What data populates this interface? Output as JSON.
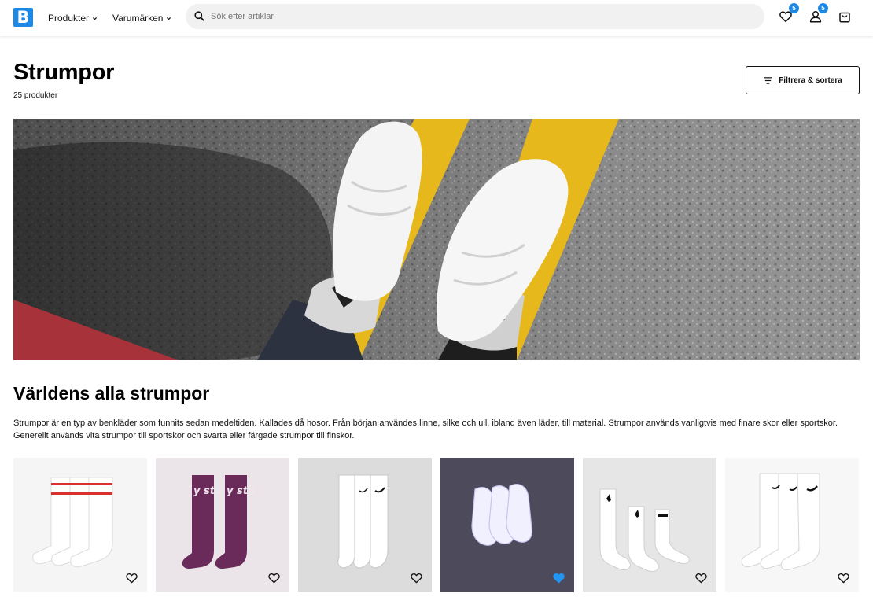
{
  "header": {
    "logo_letter": "B",
    "nav": [
      {
        "label": "Produkter"
      },
      {
        "label": "Varumärken"
      }
    ],
    "search": {
      "placeholder": "Sök efter artiklar",
      "value": ""
    },
    "wishlist_count": "5",
    "account_count": "5",
    "icons": [
      "search-icon",
      "heart-icon",
      "user-icon",
      "shopping-bag-icon",
      "chevron-down-icon",
      "filter-icon"
    ]
  },
  "page": {
    "title": "Strumpor",
    "product_count": "25 produkter",
    "filter_label": "Filtrera & sortera"
  },
  "content": {
    "heading": "Världens alla strumpor",
    "intro": "Strumpor är en typ av benkläder som funnits sedan medeltiden. Kallades då hosor. Från början användes linne, silke och ull, ibland även läder,  till material. Strumpor används vanligtvis med finare skor eller sportskor. Generellt används vita strumpor till sportskor och svarta eller färgade strumpor till finskor."
  },
  "products": [
    {
      "image": "white-nike-crew-socks-red-stripes",
      "favorited": false
    },
    {
      "image": "purple-stussy-socks",
      "favorited": false
    },
    {
      "image": "white-nike-socks-3-pack",
      "favorited": false
    },
    {
      "image": "white-nike-ankle-socks",
      "favorited": true
    },
    {
      "image": "white-jordan-socks-3-pack",
      "favorited": false
    },
    {
      "image": "white-nike-everyday-crew-socks",
      "favorited": false
    }
  ],
  "colors": {
    "brand_blue": "#1e88e5",
    "favorited_heart": "#2196f3"
  }
}
